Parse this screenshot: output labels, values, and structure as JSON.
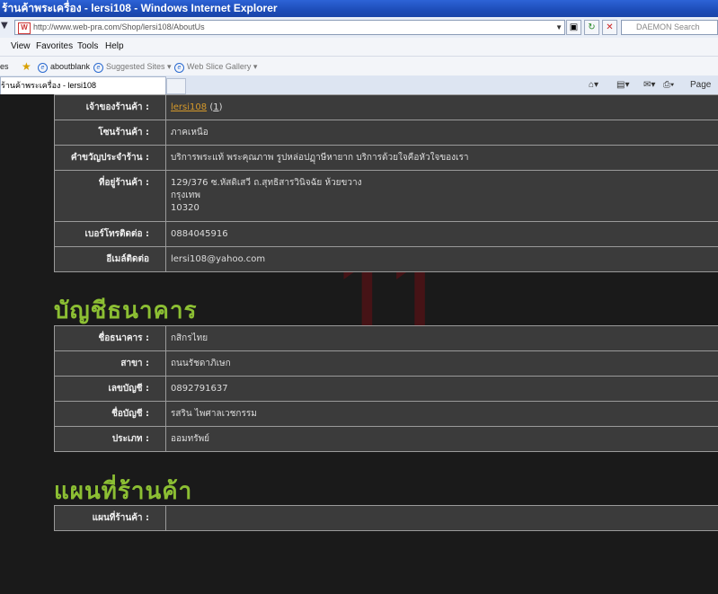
{
  "window": {
    "title": "ร้านค้าพระเครื่อง - lersi108 - Windows Internet Explorer"
  },
  "address_bar": {
    "url": "http://www.web-pra.com/Shop/lersi108/AboutUs",
    "search_placeholder": "DAEMON Search"
  },
  "menu": {
    "items": [
      "View",
      "Favorites",
      "Tools",
      "Help"
    ]
  },
  "favorites_bar": {
    "items": [
      "es",
      "aboutblank",
      "Suggested Sites ▾",
      "Web Slice Gallery ▾"
    ]
  },
  "tabs": {
    "active_label": "ร้านค้าพระเครื่อง - lersi108",
    "page_menu": "Page ▾"
  },
  "store_info": {
    "owner_label": "เจ้าของร้านค้า :",
    "owner_name": "lersi108",
    "owner_count": "1",
    "zone_label": "โซนร้านค้า :",
    "zone_value": "ภาคเหนือ",
    "slogan_label": "คำขวัญประจำร้าน :",
    "slogan_value": "บริการพระแท้ พระคุณภาพ รูปหล่อปฏุาษีหายาก บริการด้วยใจคือหัวใจของเรา",
    "address_label": "ที่อยู่ร้านค้า :",
    "address_line1": "129/376 ซ.หัสดิเสวี ถ.สุทธิสารวินิจฉัย ห้วยขวาง",
    "address_line2": "กรุงเทพ",
    "address_line3": "10320",
    "phone_label": "เบอร์โทรติดต่อ :",
    "phone_value": "0884045916",
    "email_label": "อีเมล์ติดต่อ",
    "email_value": "lersi108@yahoo.com"
  },
  "watermark": "11",
  "bank": {
    "heading": "บัญชีธนาคาร",
    "bank_name_label": "ชื่อธนาคาร :",
    "bank_name_value": "กสิกรไทย",
    "branch_label": "สาขา :",
    "branch_value": "ถนนรัชดาภิเษก",
    "account_no_label": "เลขบัญชี :",
    "account_no_value": "0892791637",
    "account_name_label": "ชื่อบัญชี :",
    "account_name_value": "รสริน ไพศาลเวชกรรม",
    "type_label": "ประเภท :",
    "type_value": "ออมทรัพย์"
  },
  "map": {
    "heading": "แผนที่ร้านค้า",
    "label": "แผนที่ร้านค้า :",
    "value": ""
  }
}
